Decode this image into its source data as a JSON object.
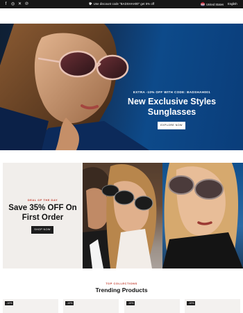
{
  "topbar": {
    "socials": [
      {
        "icon": "facebook-icon",
        "glyph": "f"
      },
      {
        "icon": "instagram-icon",
        "glyph": "◎"
      },
      {
        "icon": "x-icon",
        "glyph": "𝕏"
      },
      {
        "icon": "pinterest-icon",
        "glyph": "℗"
      }
    ],
    "announcement": "Use discount code \"BADSHAH00\" get 5% off",
    "country": "United States",
    "language": "English"
  },
  "hero": {
    "pre_title": "EXTRA -10% OFF WITH CODE: BADSHAH001",
    "title": "New Exclusive Styles Sunglasses",
    "button": "EXPLORE NOW"
  },
  "deal": {
    "kicker": "DEAL OF THE DAY",
    "title": "Save 35% OFF On First Order",
    "button": "SHOP NOW"
  },
  "collections": {
    "kicker": "TOP COLLECTIONS",
    "title": "Trending Products",
    "cards": [
      {
        "badge": "-10%"
      },
      {
        "badge": "-10%"
      },
      {
        "badge": "-10%"
      },
      {
        "badge": "-10%"
      }
    ]
  },
  "colors": {
    "topbar_bg": "#161616",
    "accent_red": "#c0392b",
    "hero_blue": "#0d4a8a",
    "deal_bg": "#f1eeeb"
  }
}
